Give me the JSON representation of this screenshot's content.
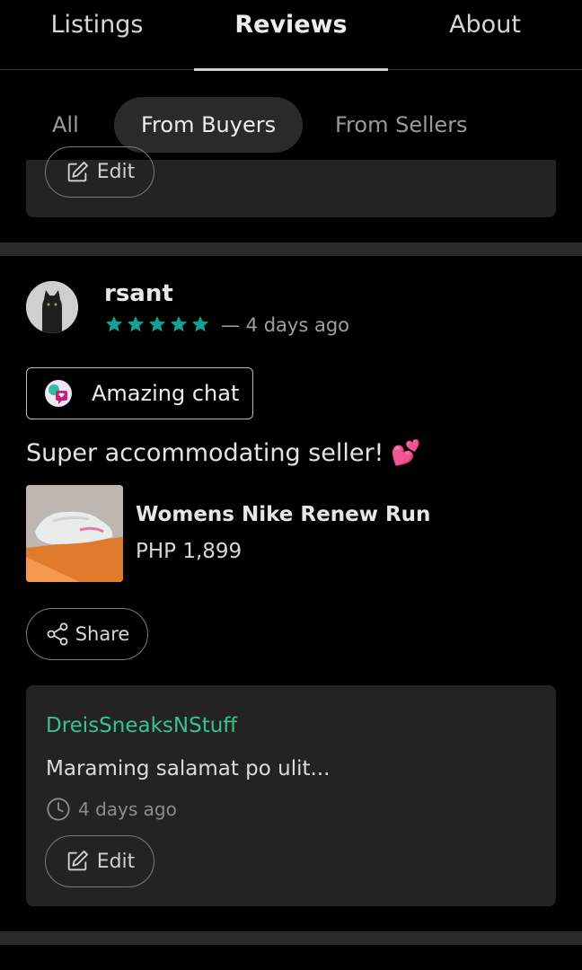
{
  "top_tabs": [
    {
      "label": "Listings"
    },
    {
      "label": "Reviews"
    },
    {
      "label": "About"
    }
  ],
  "filters": [
    {
      "label": "All"
    },
    {
      "label": "From Buyers"
    },
    {
      "label": "From Sellers"
    }
  ],
  "partial_card": {
    "edit_label": "Edit"
  },
  "review": {
    "reviewer": "rsant",
    "rating": 5,
    "time": "— 4 days ago",
    "badge_label": "Amazing chat",
    "text": "Super accommodating seller!",
    "emoji": "💕",
    "product": {
      "name": "Womens Nike Renew Run",
      "price": "PHP 1,899"
    },
    "share_label": "Share",
    "reply": {
      "author": "DreisSneaksNStuff",
      "text": "Maraming salamat po ulit...",
      "time": "4 days ago",
      "edit_label": "Edit"
    }
  },
  "colors": {
    "accent_green": "#37c48a",
    "star_teal": "#15a08f",
    "background": "#000000",
    "card": "#232323"
  }
}
